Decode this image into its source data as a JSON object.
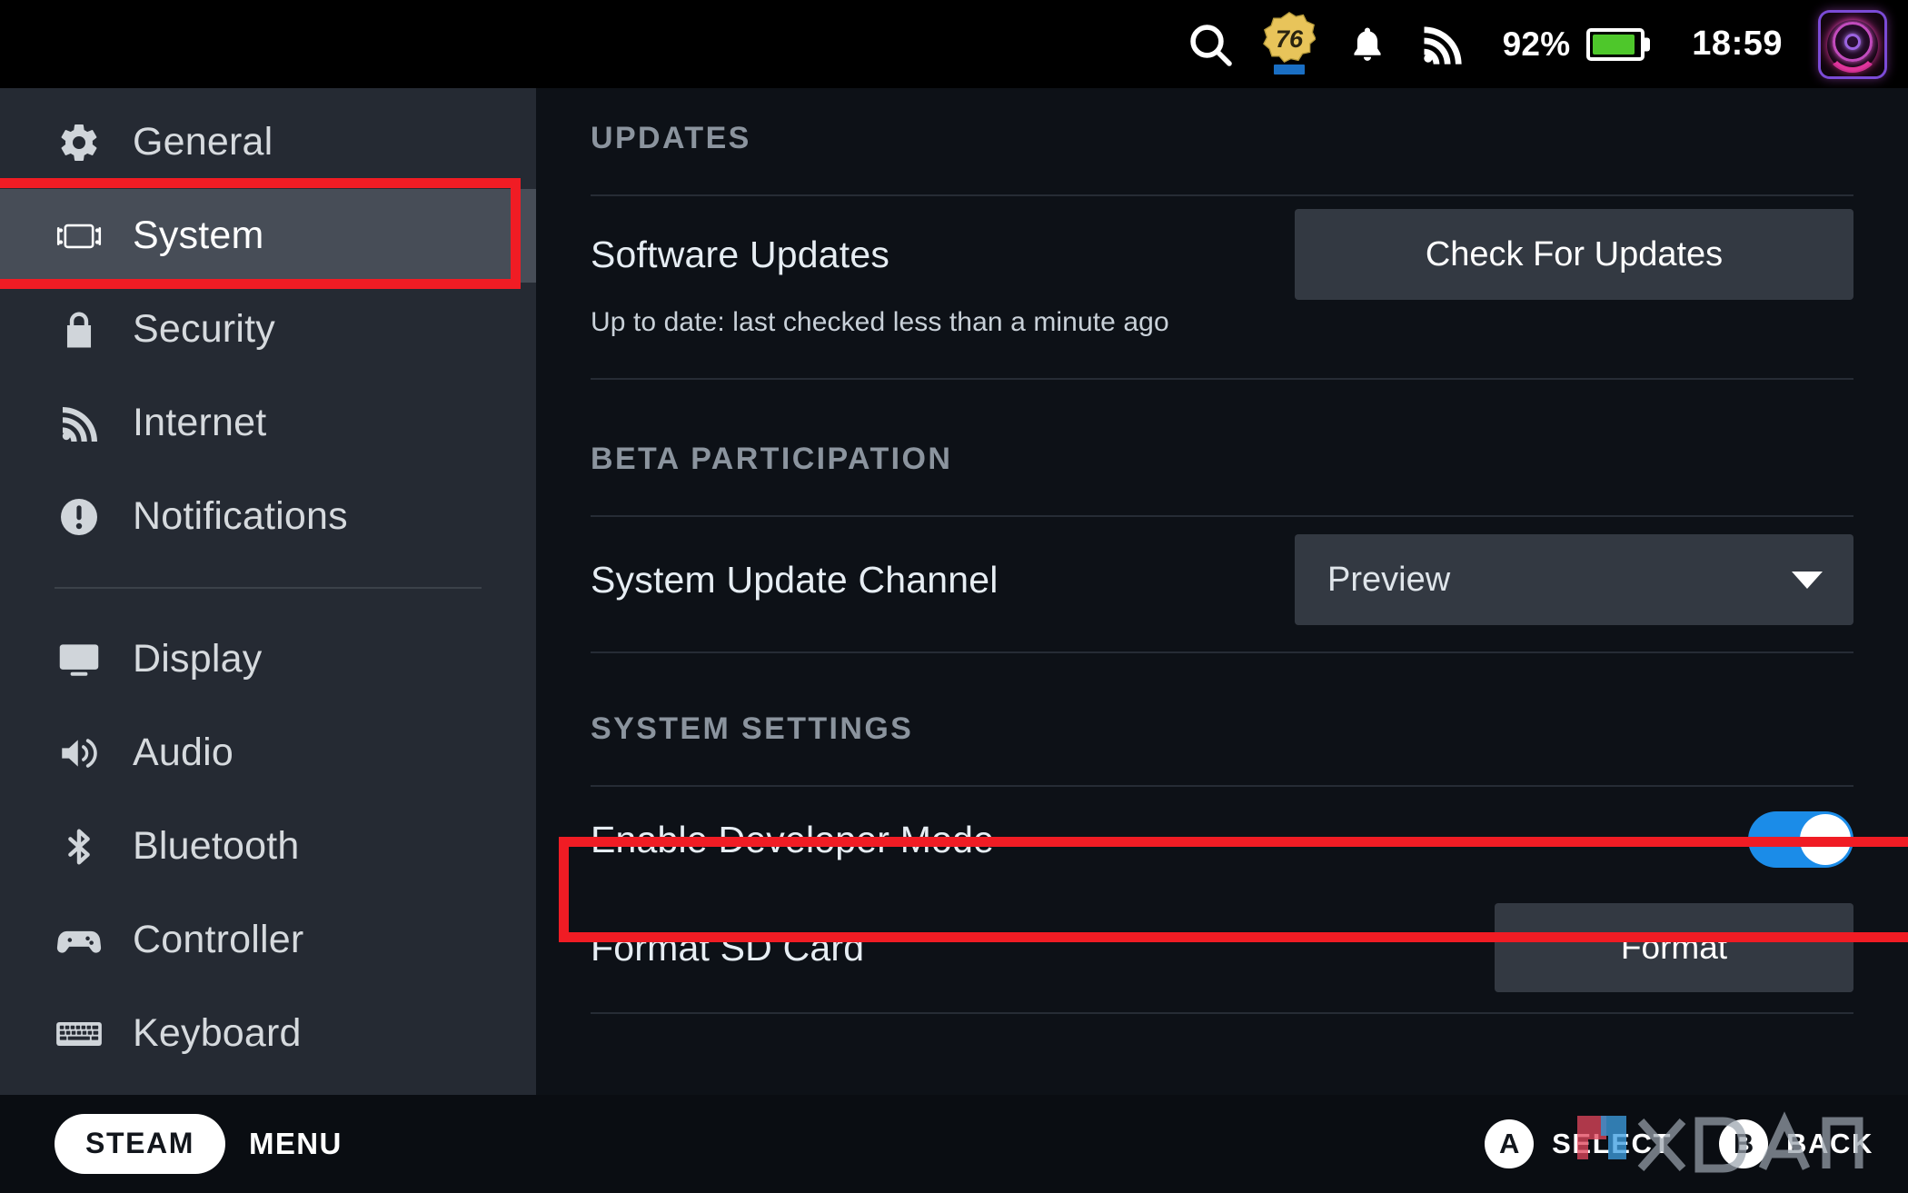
{
  "topbar": {
    "search_icon": "search-icon",
    "game_badge": {
      "label": "76",
      "name": "fallout-76-game-icon"
    },
    "notification_icon": "bell-icon",
    "wifi_icon": "wifi-icon",
    "battery_percent": "92%",
    "battery_level": 92,
    "battery_color": "#4ec72b",
    "clock": "18:59",
    "avatar": "user-avatar"
  },
  "sidebar": {
    "items": [
      {
        "label": "General",
        "icon": "gear-icon",
        "selected": false
      },
      {
        "label": "System",
        "icon": "steam-deck-icon",
        "selected": true
      },
      {
        "label": "Security",
        "icon": "lock-icon",
        "selected": false
      },
      {
        "label": "Internet",
        "icon": "wifi-icon",
        "selected": false
      },
      {
        "label": "Notifications",
        "icon": "alert-circle-icon",
        "selected": false
      },
      {
        "label": "Display",
        "icon": "monitor-icon",
        "selected": false
      },
      {
        "label": "Audio",
        "icon": "speaker-icon",
        "selected": false
      },
      {
        "label": "Bluetooth",
        "icon": "bluetooth-icon",
        "selected": false
      },
      {
        "label": "Controller",
        "icon": "gamepad-icon",
        "selected": false
      },
      {
        "label": "Keyboard",
        "icon": "keyboard-icon",
        "selected": false
      }
    ]
  },
  "main": {
    "sections": [
      {
        "title": "UPDATES",
        "rows": [
          {
            "label": "Software Updates",
            "control": "button",
            "button_label": "Check For Updates",
            "subtext": "Up to date: last checked less than a minute ago"
          }
        ]
      },
      {
        "title": "BETA PARTICIPATION",
        "rows": [
          {
            "label": "System Update Channel",
            "control": "dropdown",
            "value": "Preview"
          }
        ]
      },
      {
        "title": "SYSTEM SETTINGS",
        "rows": [
          {
            "label": "Enable Developer Mode",
            "control": "toggle",
            "toggle_on": true,
            "toggle_color": "#1b8ce8"
          },
          {
            "label": "Format SD Card",
            "control": "button",
            "button_label": "Format"
          }
        ]
      }
    ]
  },
  "bottombar": {
    "steam_label": "STEAM",
    "menu_label": "MENU",
    "hints": [
      {
        "button": "A",
        "label": "SELECT"
      },
      {
        "button": "B",
        "label": "BACK"
      }
    ],
    "watermark": "XDA"
  },
  "annotations": {
    "highlight_color": "#f01c24",
    "boxes": [
      {
        "target": "sidebar-item-system"
      },
      {
        "target": "row-enable-developer-mode"
      }
    ]
  }
}
